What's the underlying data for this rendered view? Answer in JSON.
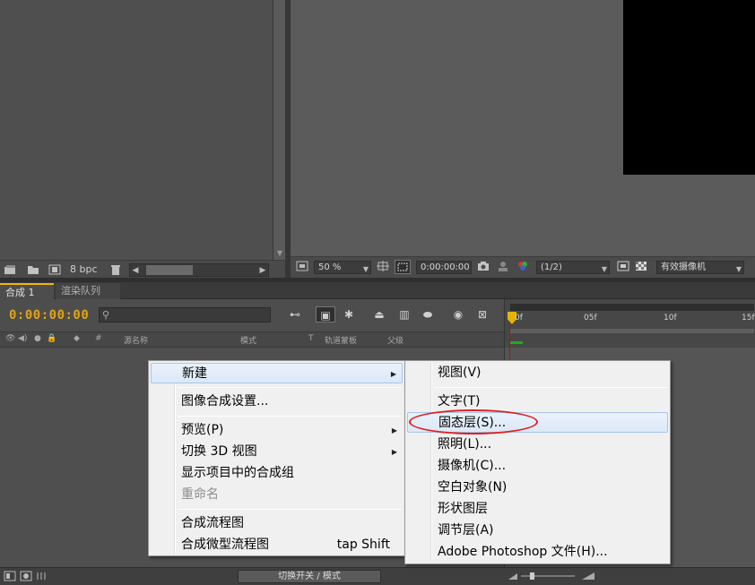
{
  "project": {
    "bpc": "8 bpc",
    "icons": [
      "interpret-footage-icon",
      "new-folder-icon",
      "new-composition-icon",
      "trash-icon"
    ]
  },
  "viewer": {
    "zoom": "50 %",
    "timecode": "0:00:00:00",
    "resolution": "(1/2)",
    "camera": "有效摄像机"
  },
  "timeline": {
    "tabs": [
      "合成 1",
      "渲染队列"
    ],
    "timecode": "0:00:00:00",
    "columns": {
      "source_name": "源名称",
      "mode": "模式",
      "t": "T",
      "trkmat": "轨道蒙板",
      "parent": "父级",
      "hash": "#"
    },
    "ruler": [
      "0f",
      "05f",
      "10f",
      "15f"
    ],
    "footer_toggle": "切换开关 / 模式"
  },
  "context_menu": {
    "items": [
      {
        "label": "新建",
        "submenu": true,
        "highlight": true
      },
      {
        "label": "图像合成设置..."
      },
      {
        "label": "预览(P)",
        "submenu": true
      },
      {
        "label": "切换 3D 视图",
        "submenu": true
      },
      {
        "label": "显示项目中的合成组"
      },
      {
        "label": "重命名",
        "disabled": true
      },
      {
        "label": "合成流程图"
      },
      {
        "label": "合成微型流程图",
        "shortcut": "tap Shift"
      }
    ]
  },
  "submenu": {
    "items": [
      {
        "label": "视图(V)"
      },
      {
        "label": "文字(T)"
      },
      {
        "label": "固态层(S)...",
        "highlight": true
      },
      {
        "label": "照明(L)..."
      },
      {
        "label": "摄像机(C)..."
      },
      {
        "label": "空白对象(N)"
      },
      {
        "label": "形状图层"
      },
      {
        "label": "调节层(A)"
      },
      {
        "label": "Adobe Photoshop 文件(H)..."
      }
    ]
  },
  "colors": {
    "timecode": "#e1a410",
    "annotation_circle": "#e02020",
    "menu_highlight": "#dbe8f7"
  }
}
